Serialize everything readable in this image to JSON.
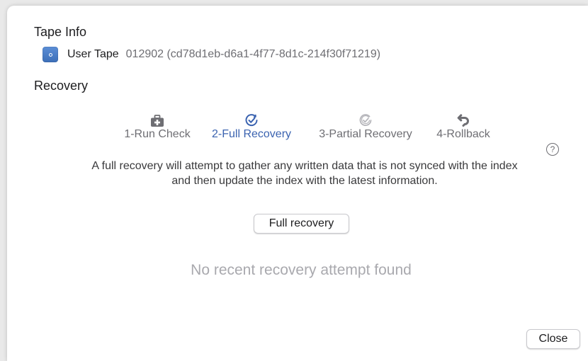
{
  "tape_info": {
    "heading": "Tape Info",
    "tape_name": "User Tape",
    "tape_id": "012902 (cd78d1eb-d6a1-4f77-8d1c-214f30f71219)"
  },
  "recovery": {
    "heading": "Recovery",
    "steps": [
      {
        "label": "1-Run Check",
        "icon": "first-aid-kit-icon",
        "state": "inactive"
      },
      {
        "label": "2-Full Recovery",
        "icon": "check-circle-icon",
        "state": "active"
      },
      {
        "label": "3-Partial Recovery",
        "icon": "partial-check-circle-icon",
        "state": "inactive"
      },
      {
        "label": "4-Rollback",
        "icon": "rollback-arrow-icon",
        "state": "inactive"
      }
    ],
    "help_glyph": "?",
    "description_line1": "A full recovery will attempt to gather any written data that is not synced with the index",
    "description_line2": "and then update the index with the latest information.",
    "action_button_label": "Full recovery",
    "status_text": "No recent recovery attempt found"
  },
  "footer": {
    "close_label": "Close"
  },
  "colors": {
    "accent": "#3b63b0",
    "muted_text": "#6e6e73",
    "placeholder_text": "#a9a9ae",
    "tape_icon": "#4a7cc6"
  }
}
